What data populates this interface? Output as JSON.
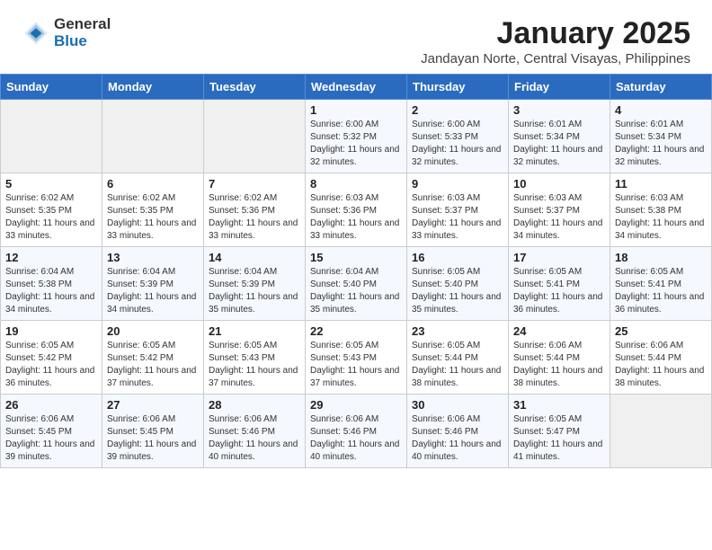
{
  "header": {
    "logo_general": "General",
    "logo_blue": "Blue",
    "month_title": "January 2025",
    "location": "Jandayan Norte, Central Visayas, Philippines"
  },
  "weekdays": [
    "Sunday",
    "Monday",
    "Tuesday",
    "Wednesday",
    "Thursday",
    "Friday",
    "Saturday"
  ],
  "weeks": [
    [
      {
        "day": "",
        "info": ""
      },
      {
        "day": "",
        "info": ""
      },
      {
        "day": "",
        "info": ""
      },
      {
        "day": "1",
        "info": "Sunrise: 6:00 AM\nSunset: 5:32 PM\nDaylight: 11 hours and 32 minutes."
      },
      {
        "day": "2",
        "info": "Sunrise: 6:00 AM\nSunset: 5:33 PM\nDaylight: 11 hours and 32 minutes."
      },
      {
        "day": "3",
        "info": "Sunrise: 6:01 AM\nSunset: 5:34 PM\nDaylight: 11 hours and 32 minutes."
      },
      {
        "day": "4",
        "info": "Sunrise: 6:01 AM\nSunset: 5:34 PM\nDaylight: 11 hours and 32 minutes."
      }
    ],
    [
      {
        "day": "5",
        "info": "Sunrise: 6:02 AM\nSunset: 5:35 PM\nDaylight: 11 hours and 33 minutes."
      },
      {
        "day": "6",
        "info": "Sunrise: 6:02 AM\nSunset: 5:35 PM\nDaylight: 11 hours and 33 minutes."
      },
      {
        "day": "7",
        "info": "Sunrise: 6:02 AM\nSunset: 5:36 PM\nDaylight: 11 hours and 33 minutes."
      },
      {
        "day": "8",
        "info": "Sunrise: 6:03 AM\nSunset: 5:36 PM\nDaylight: 11 hours and 33 minutes."
      },
      {
        "day": "9",
        "info": "Sunrise: 6:03 AM\nSunset: 5:37 PM\nDaylight: 11 hours and 33 minutes."
      },
      {
        "day": "10",
        "info": "Sunrise: 6:03 AM\nSunset: 5:37 PM\nDaylight: 11 hours and 34 minutes."
      },
      {
        "day": "11",
        "info": "Sunrise: 6:03 AM\nSunset: 5:38 PM\nDaylight: 11 hours and 34 minutes."
      }
    ],
    [
      {
        "day": "12",
        "info": "Sunrise: 6:04 AM\nSunset: 5:38 PM\nDaylight: 11 hours and 34 minutes."
      },
      {
        "day": "13",
        "info": "Sunrise: 6:04 AM\nSunset: 5:39 PM\nDaylight: 11 hours and 34 minutes."
      },
      {
        "day": "14",
        "info": "Sunrise: 6:04 AM\nSunset: 5:39 PM\nDaylight: 11 hours and 35 minutes."
      },
      {
        "day": "15",
        "info": "Sunrise: 6:04 AM\nSunset: 5:40 PM\nDaylight: 11 hours and 35 minutes."
      },
      {
        "day": "16",
        "info": "Sunrise: 6:05 AM\nSunset: 5:40 PM\nDaylight: 11 hours and 35 minutes."
      },
      {
        "day": "17",
        "info": "Sunrise: 6:05 AM\nSunset: 5:41 PM\nDaylight: 11 hours and 36 minutes."
      },
      {
        "day": "18",
        "info": "Sunrise: 6:05 AM\nSunset: 5:41 PM\nDaylight: 11 hours and 36 minutes."
      }
    ],
    [
      {
        "day": "19",
        "info": "Sunrise: 6:05 AM\nSunset: 5:42 PM\nDaylight: 11 hours and 36 minutes."
      },
      {
        "day": "20",
        "info": "Sunrise: 6:05 AM\nSunset: 5:42 PM\nDaylight: 11 hours and 37 minutes."
      },
      {
        "day": "21",
        "info": "Sunrise: 6:05 AM\nSunset: 5:43 PM\nDaylight: 11 hours and 37 minutes."
      },
      {
        "day": "22",
        "info": "Sunrise: 6:05 AM\nSunset: 5:43 PM\nDaylight: 11 hours and 37 minutes."
      },
      {
        "day": "23",
        "info": "Sunrise: 6:05 AM\nSunset: 5:44 PM\nDaylight: 11 hours and 38 minutes."
      },
      {
        "day": "24",
        "info": "Sunrise: 6:06 AM\nSunset: 5:44 PM\nDaylight: 11 hours and 38 minutes."
      },
      {
        "day": "25",
        "info": "Sunrise: 6:06 AM\nSunset: 5:44 PM\nDaylight: 11 hours and 38 minutes."
      }
    ],
    [
      {
        "day": "26",
        "info": "Sunrise: 6:06 AM\nSunset: 5:45 PM\nDaylight: 11 hours and 39 minutes."
      },
      {
        "day": "27",
        "info": "Sunrise: 6:06 AM\nSunset: 5:45 PM\nDaylight: 11 hours and 39 minutes."
      },
      {
        "day": "28",
        "info": "Sunrise: 6:06 AM\nSunset: 5:46 PM\nDaylight: 11 hours and 40 minutes."
      },
      {
        "day": "29",
        "info": "Sunrise: 6:06 AM\nSunset: 5:46 PM\nDaylight: 11 hours and 40 minutes."
      },
      {
        "day": "30",
        "info": "Sunrise: 6:06 AM\nSunset: 5:46 PM\nDaylight: 11 hours and 40 minutes."
      },
      {
        "day": "31",
        "info": "Sunrise: 6:05 AM\nSunset: 5:47 PM\nDaylight: 11 hours and 41 minutes."
      },
      {
        "day": "",
        "info": ""
      }
    ]
  ]
}
